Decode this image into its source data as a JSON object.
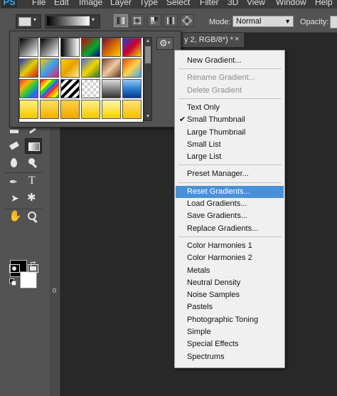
{
  "app": {
    "logo": "PS",
    "menu": [
      "File",
      "Edit",
      "Image",
      "Layer",
      "Type",
      "Select",
      "Filter",
      "3D",
      "View",
      "Window",
      "Help"
    ]
  },
  "options_bar": {
    "mode_label": "Mode:",
    "mode_value": "Normal",
    "opacity_label": "Opacity:"
  },
  "document_tab": {
    "title": "y 2, RGB/8*) *",
    "close": "×"
  },
  "ruler": {
    "label": "0"
  },
  "gradient_picker": {
    "gear_icon": "gear-icon",
    "swatches": [
      "linear-gradient(135deg,#000 0%,#fff 100%)",
      "linear-gradient(135deg,#000 0%,transparent 100%)",
      "linear-gradient(90deg,#000 0%,#888 50%,#fff 100%)",
      "linear-gradient(135deg,#c00,#0a3 60%,#008)",
      "linear-gradient(135deg,#7a0c3a,#e07a00 60%,#f4d000)",
      "linear-gradient(135deg,#2b3bd8,#c9002f 50%,#f8d600)",
      "linear-gradient(135deg,#1a2fd8,#e3cf00 50%,#cc1e1e)",
      "linear-gradient(135deg,#f4c800,#3aa0f0 50%,#e91e63)",
      "linear-gradient(135deg,#f6d200,#e8a000 50%,#ffef8c)",
      "linear-gradient(135deg,#4a6ee0,#f2d300 50%,#2a7a2a)",
      "linear-gradient(135deg,#7a4a2a,#f0c9a0 50%,#6a3a1a)",
      "linear-gradient(135deg,#f24b00,#ffd24a 50%,#3aa8ff)",
      "linear-gradient(135deg,#f1364a,#f7b500 30%,#2ac940 55%,#1c6ef2 80%,#9b3bd8)",
      "repeating-linear-gradient(135deg,#e33 0 4px,#f90 4px 8px,#ee0 8px 12px,#3c3 12px 16px,#36f 16px 20px)",
      "repeating-linear-gradient(135deg,#000 0 4px,#fff 4px 8px)",
      "repeating-conic-gradient(#cfcfcf 0 25%,#fff 0 50%) 0 0/8px 8px",
      "linear-gradient(180deg,#ddd,#888 50%,#333)",
      "linear-gradient(180deg,#9bc7f0,#2a80d0 50%,#0a3a90)",
      "linear-gradient(180deg,#fff27a,#f3c500 100%)",
      "linear-gradient(180deg,#ffe066,#f0b000 100%)",
      "linear-gradient(180deg,#ffd24a,#f0a800 100%)",
      "linear-gradient(180deg,#ffef8c,#f4c800 100%)",
      "linear-gradient(180deg,#fff7b0,#f6d200 100%)",
      "linear-gradient(180deg,#ffe27a,#f5c000 100%)"
    ]
  },
  "context_menu": {
    "items": [
      {
        "label": "New Gradient...",
        "disabled": false
      },
      {
        "sep": true
      },
      {
        "label": "Rename Gradient...",
        "disabled": true
      },
      {
        "label": "Delete Gradient",
        "disabled": true
      },
      {
        "sep": true
      },
      {
        "label": "Text Only"
      },
      {
        "label": "Small Thumbnail",
        "checked": true
      },
      {
        "label": "Large Thumbnail"
      },
      {
        "label": "Small List"
      },
      {
        "label": "Large List"
      },
      {
        "sep": true
      },
      {
        "label": "Preset Manager..."
      },
      {
        "sep": true
      },
      {
        "label": "Reset Gradients...",
        "highlighted": true
      },
      {
        "label": "Load Gradients..."
      },
      {
        "label": "Save Gradients..."
      },
      {
        "label": "Replace Gradients..."
      },
      {
        "sep": true
      },
      {
        "label": "Color Harmonies 1"
      },
      {
        "label": "Color Harmonies 2"
      },
      {
        "label": "Metals"
      },
      {
        "label": "Neutral Density"
      },
      {
        "label": "Noise Samples"
      },
      {
        "label": "Pastels"
      },
      {
        "label": "Photographic Toning"
      },
      {
        "label": "Simple"
      },
      {
        "label": "Special Effects"
      },
      {
        "label": "Spectrums"
      }
    ]
  },
  "toolbar": {
    "tools": [
      "brush-tool",
      "eraser-tool",
      "gradient-tool",
      "blur-tool",
      "dodge-tool",
      "pen-tool",
      "type-tool",
      "path-select-tool",
      "shape-tool",
      "hand-tool",
      "zoom-tool",
      "quick-mask-tool",
      "screen-mode-tool"
    ]
  },
  "colors": {
    "highlight": "#4a90d9",
    "app_bg": "#282828",
    "panel_bg": "#535353"
  }
}
